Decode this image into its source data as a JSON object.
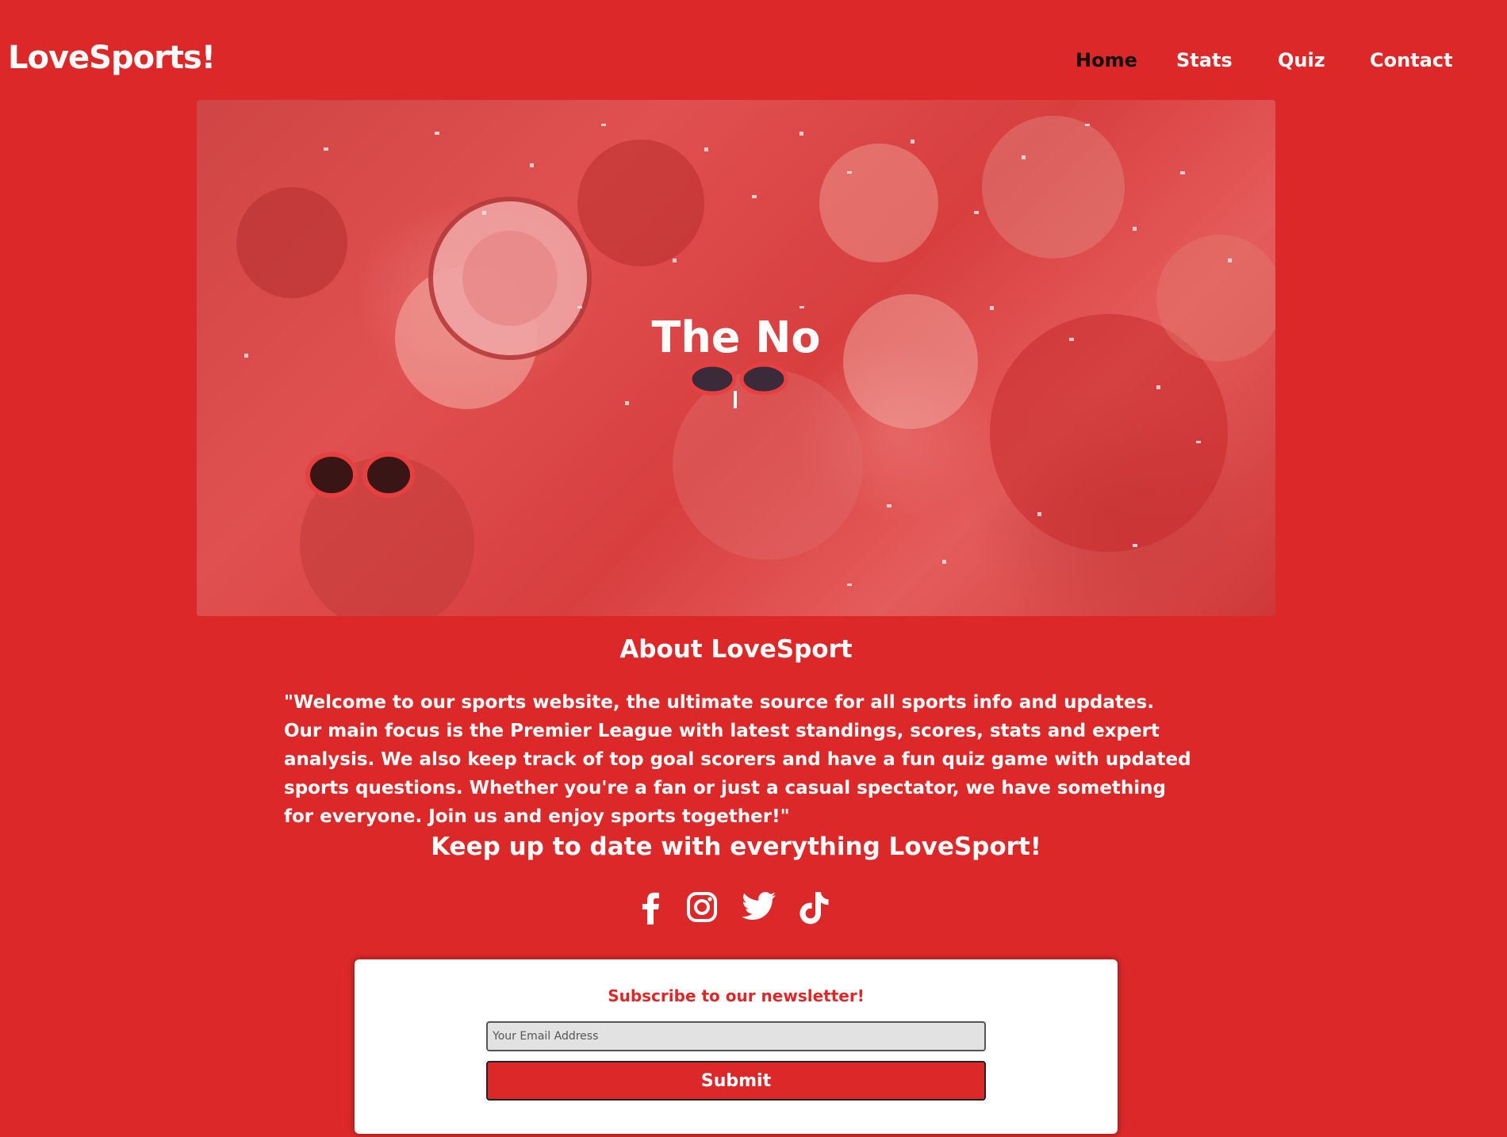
{
  "site": {
    "logo": "LoveSports!"
  },
  "nav": {
    "items": [
      {
        "label": "Home",
        "active": true
      },
      {
        "label": "Stats",
        "active": false
      },
      {
        "label": "Quiz",
        "active": false
      },
      {
        "label": "Contact",
        "active": false
      }
    ]
  },
  "hero": {
    "title": "The No"
  },
  "about": {
    "title": "About LoveSport",
    "text": "\"Welcome to our sports website, the ultimate source for all sports info and updates. Our main focus is the Premier League with latest standings, scores, stats and expert analysis. We also keep track of top goal scorers and have a fun quiz game with updated sports questions. Whether you're a fan or just a casual spectator, we have something for everyone. Join us and enjoy sports together!\""
  },
  "social": {
    "heading": "Keep up to date with everything LoveSport!",
    "icons": [
      "facebook-icon",
      "instagram-icon",
      "twitter-icon",
      "tiktok-icon"
    ]
  },
  "newsletter": {
    "title": "Subscribe to our newsletter!",
    "email_placeholder": "Your Email Address",
    "submit_label": "Submit"
  },
  "colors": {
    "background": "#dc2828",
    "active_nav": "#111111",
    "card": "#ffffff"
  }
}
